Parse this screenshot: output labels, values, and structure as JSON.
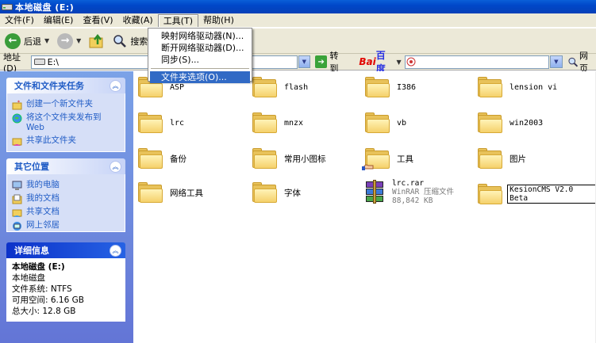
{
  "window": {
    "title": "本地磁盘 (E:)"
  },
  "menu": [
    "文件(F)",
    "编辑(E)",
    "查看(V)",
    "收藏(A)",
    "工具(T)",
    "帮助(H)"
  ],
  "toolbar": {
    "back_label": "后退",
    "search_label": "搜索"
  },
  "address": {
    "label": "地址(D)",
    "value": "E:\\",
    "goto_label": "转到",
    "baidu_brand": "Bai",
    "baidu_brand2": "百度",
    "right_cut": "网页"
  },
  "tools_menu": {
    "items": [
      "映射网络驱动器(N)...",
      "断开网络驱动器(D)...",
      "同步(S)...",
      "文件夹选项(O)..."
    ],
    "selected": "文件夹选项(O)..."
  },
  "tasks_panel": {
    "title": "文件和文件夹任务",
    "items": [
      "创建一个新文件夹",
      "将这个文件夹发布到 Web",
      "共享此文件夹"
    ]
  },
  "places_panel": {
    "title": "其它位置",
    "items": [
      "我的电脑",
      "我的文档",
      "共享文档",
      "网上邻居"
    ]
  },
  "details_panel": {
    "title": "详细信息",
    "name": "本地磁盘 (E:)",
    "type": "本地磁盘",
    "fs": "文件系统: NTFS",
    "free": "可用空间: 6.16 GB",
    "total": "总大小: 12.8 GB"
  },
  "files": [
    {
      "name": "ASP",
      "kind": "folder"
    },
    {
      "name": "flash",
      "kind": "folder"
    },
    {
      "name": "I386",
      "kind": "folder"
    },
    {
      "name": "lension vi",
      "kind": "folder"
    },
    {
      "name": "lrc",
      "kind": "folder"
    },
    {
      "name": "mnzx",
      "kind": "folder"
    },
    {
      "name": "vb",
      "kind": "folder"
    },
    {
      "name": "win2003",
      "kind": "folder"
    },
    {
      "name": "备份",
      "kind": "folder"
    },
    {
      "name": "常用小图标",
      "kind": "folder"
    },
    {
      "name": "工具",
      "kind": "folder-shared"
    },
    {
      "name": "图片",
      "kind": "folder"
    },
    {
      "name": "网络工具",
      "kind": "folder"
    },
    {
      "name": "字体",
      "kind": "folder"
    },
    {
      "name": "lrc.rar",
      "kind": "rar",
      "desc": "WinRAR 压缩文件",
      "size": "88,842 KB"
    },
    {
      "name": "KesionCMS V2.0 Beta",
      "kind": "folder-rename"
    }
  ],
  "colors": {
    "xp_blue": "#0047c8",
    "pane_blue": "#6375d6",
    "link_blue": "#215dc6",
    "highlight": "#316ac5"
  }
}
